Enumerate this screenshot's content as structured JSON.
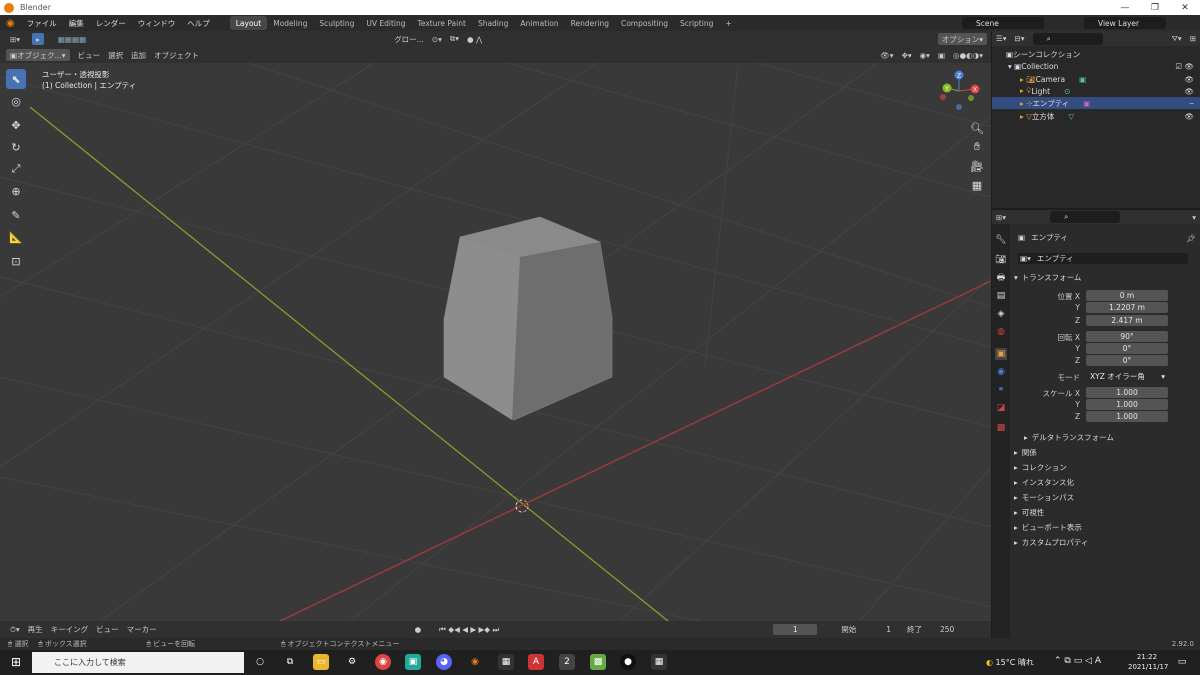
{
  "window": {
    "title": "Blender",
    "min": "—",
    "max": "❐",
    "close": "✕"
  },
  "menu": [
    "ファイル",
    "編集",
    "レンダー",
    "ウィンドウ",
    "ヘルプ"
  ],
  "workspaces": [
    "Layout",
    "Modeling",
    "Sculpting",
    "UV Editing",
    "Texture Paint",
    "Shading",
    "Animation",
    "Rendering",
    "Compositing",
    "Scripting",
    "+"
  ],
  "scene": "Scene",
  "view_layer": "View Layer",
  "tool_header": {
    "transform": "グロー...",
    "options": "オプション"
  },
  "viewport_header": {
    "mode": "オブジェク...",
    "items": [
      "ビュー",
      "選択",
      "追加",
      "オブジェクト"
    ]
  },
  "viewport": {
    "view_name": "ユーザー・透視投影",
    "context": "(1) Collection | エンプティ"
  },
  "gizmo": {
    "x": "X",
    "y": "Y",
    "z": "Z"
  },
  "outliner": {
    "title": "シーンコレクション",
    "collection": "Collection",
    "items": [
      "Camera",
      "Light",
      "エンプティ",
      "立方体"
    ]
  },
  "properties": {
    "object_name": "エンプティ",
    "data_name": "エンプティ",
    "transform_header": "トランスフォーム",
    "loc_label": "位置 X",
    "loc": [
      "0 m",
      "1.2207 m",
      "2.417 m"
    ],
    "rot_label": "回転 X",
    "rot": [
      "90°",
      "0°",
      "0°"
    ],
    "mode_label": "モード",
    "mode": "XYZ オイラー角",
    "scale_label": "スケール X",
    "scale": [
      "1.000",
      "1.000",
      "1.000"
    ],
    "y_label": "Y",
    "z_label": "Z",
    "delta": "デルタトランスフォーム",
    "panels": [
      "関係",
      "コレクション",
      "インスタンス化",
      "モーションパス",
      "可視性",
      "ビューポート表示",
      "カスタムプロパティ"
    ]
  },
  "timeline": {
    "items": [
      "再生",
      "キーイング",
      "ビュー",
      "マーカー"
    ],
    "frame": "1",
    "start_label": "開始",
    "start": "1",
    "end_label": "終了",
    "end": "250"
  },
  "status": {
    "select": "選択",
    "box": "ボックス選択",
    "rotate": "ビューを回転",
    "context": "オブジェクトコンテクストメニュー",
    "version": "2.92.0"
  },
  "taskbar": {
    "search": "ここに入力して検索",
    "weather": "15°C 晴れ",
    "ime": "A",
    "time": "21:22",
    "date": "2021/11/17"
  }
}
